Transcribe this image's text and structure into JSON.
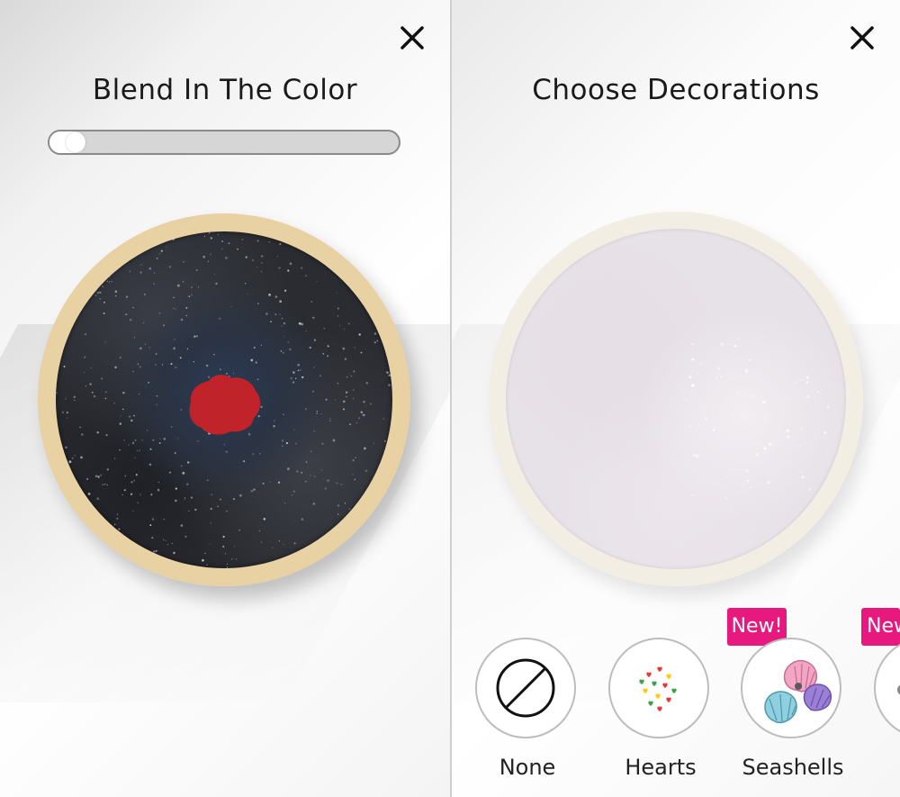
{
  "left_screen": {
    "title": "Blend In The Color",
    "close_icon": "close-icon",
    "blend_progress": 0.05,
    "cookie": {
      "icing_color": "#2a2c31",
      "drop_color": "#c0232a",
      "rim_color": "#e7cf9f"
    }
  },
  "right_screen": {
    "title": "Choose Decorations",
    "close_icon": "close-icon",
    "cookie": {
      "icing_color": "#e7e2e7",
      "rim_color": "#f2ede2"
    },
    "options": [
      {
        "label": "None",
        "icon": "none-prohibited-icon",
        "badge": ""
      },
      {
        "label": "Hearts",
        "icon": "hearts-sprinkles-icon",
        "badge": ""
      },
      {
        "label": "Seashells",
        "icon": "seashells-icon",
        "badge": "New!"
      },
      {
        "label": "",
        "icon": "partial-option-icon",
        "badge": "New!"
      }
    ]
  },
  "colors": {
    "badge": "#e8197e",
    "text": "#1a1a1a",
    "option_border": "#bdbdbd"
  }
}
